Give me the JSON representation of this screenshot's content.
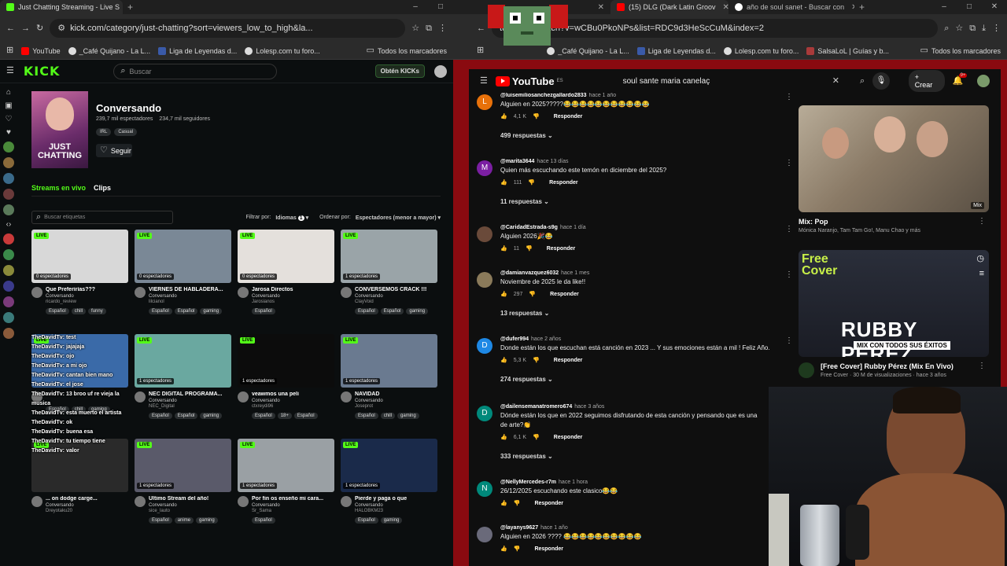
{
  "left_window": {
    "tabs": [
      {
        "label": "Just Chatting Streaming - Live S"
      }
    ],
    "url": "kick.com/category/just-chatting?sort=viewers_low_to_high&la...",
    "bookmarks": [
      "YouTube",
      "_Café Quijano - La L...",
      "Liga de Leyendas d...",
      "Lolesp.com tu foro...",
      "Todos los marcadores"
    ],
    "kick": {
      "logo": "KICK",
      "search_placeholder": "Buscar",
      "cta": "Obtén KICKs",
      "category": {
        "title": "Conversando",
        "viewers": "239,7 mil espectadores",
        "followers": "234,7 mil seguidores",
        "chips": [
          "IRL",
          "Casual"
        ],
        "follow_label": "Seguir",
        "image_text": "JUST CHATTING"
      },
      "tabs": [
        "Streams en vivo",
        "Clips"
      ],
      "tag_search_placeholder": "Buscar etiquetas",
      "filter_label": "Filtrar por:",
      "filter_value": "Idiomas",
      "filter_count": "1",
      "sort_label": "Ordenar por:",
      "sort_value": "Espectadores (menor a mayor)",
      "live_badge": "LIVE",
      "streams": [
        {
          "title": "Que Preferirías???",
          "category": "Conversando",
          "user": "ricardo_review",
          "viewers": "0 espectadores",
          "tags": [
            "Español",
            "chill",
            "funny"
          ],
          "bg": "#d8d8d8"
        },
        {
          "title": "VIERNES DE HABLADERA...",
          "category": "Conversando",
          "user": "lilcianol",
          "viewers": "0 espectadores",
          "tags": [
            "Español",
            "Español",
            "gaming"
          ],
          "bg": "#7a8896"
        },
        {
          "title": "Jarosa Directos",
          "category": "Conversando",
          "user": "Jarosianos",
          "viewers": "0 espectadores",
          "tags": [
            "Español"
          ],
          "bg": "#e4e0dc"
        },
        {
          "title": "CONVERSEMOS CRACK !!!",
          "category": "Conversando",
          "user": "ClayVoid",
          "viewers": "1 espectadores",
          "tags": [
            "Español",
            "Español",
            "gaming"
          ],
          "bg": "#9aa4a8"
        },
        {
          "title": "",
          "category": "",
          "user": "",
          "viewers": "",
          "tags": [
            "Español",
            "chill",
            "gaming"
          ],
          "bg": "#3a6aa8"
        },
        {
          "title": "NEC DIGITAL PROGRAMA...",
          "category": "Conversando",
          "user": "NEC_Digital",
          "viewers": "1 espectadores",
          "tags": [
            "Español",
            "Español",
            "gaming"
          ],
          "bg": "#6aa8a0"
        },
        {
          "title": "veawmos una peli",
          "category": "Conversando",
          "user": "ctxreydi96",
          "viewers": "1 espectadores",
          "tags": [
            "Español",
            "18+",
            "Español"
          ],
          "bg": "#0c0c0c"
        },
        {
          "title": "NAVIDAD",
          "category": "Conversando",
          "user": "Joseprot",
          "viewers": "1 espectadores",
          "tags": [
            "Español",
            "chill",
            "gaming"
          ],
          "bg": "#6a7a90"
        },
        {
          "title": "... on dodge carge...",
          "category": "Conversando",
          "user": "Dreyotaku20",
          "viewers": "",
          "tags": [],
          "bg": "#2a2a2a"
        },
        {
          "title": "Ultimo Stream del año!",
          "category": "Conversando",
          "user": "sice_lauto",
          "viewers": "1 espectadores",
          "tags": [
            "Español",
            "anime",
            "gaming"
          ],
          "bg": "#5a5a6a"
        },
        {
          "title": "Por fin os enseño mi cara...",
          "category": "Conversando",
          "user": "Sr_Sama",
          "viewers": "1 espectadores",
          "tags": [
            "Español"
          ],
          "bg": "#9aa0a4"
        },
        {
          "title": "Pierde y paga o que",
          "category": "Conversando",
          "user": "HALOBKM23",
          "viewers": "1 espectadores",
          "tags": [
            "Español",
            "gaming"
          ],
          "bg": "#1a2a4a"
        }
      ],
      "chat_overlay": [
        "TheDavidTv: test",
        "TheDavidTv: jajajaja",
        "TheDavidTv: ojo",
        "TheDavidTv: a mi ojo",
        "TheDavidTv: cantan bien mano",
        "TheDavidTv: el jose",
        "TheDavidTv: 13 broo uf re vieja la musica",
        "TheDavidTv: esta muerto el artista",
        "TheDavidTv: ok",
        "TheDavidTv: buena esa",
        "TheDavidTv: tu tiempo tiene",
        "TheDavidTv: valor"
      ]
    }
  },
  "right_window": {
    "tabs": [
      {
        "label": "(15) DLG (Dark Latin Groov"
      },
      {
        "label": "año de soul sanet - Buscar con"
      }
    ],
    "url": "tube.com/watch?v=wCBu0PkoNPs&list=RDC9d3HeScCuM&index=2",
    "bookmarks": [
      "_Café Quijano - La L...",
      "Liga de Leyendas d...",
      "Lolesp.com tu foro...",
      "SalsaLoL | Guías y b...",
      "Todos los marcadores"
    ],
    "youtube": {
      "logo": "YouTube",
      "logo_sup": "ES",
      "search_value": "soul sante maria canelaç",
      "create_label": "Crear",
      "notif_count": "9+",
      "reply_label": "Responder",
      "comments": [
        {
          "author": "@luisemiliosanchezgallardo2833",
          "time": "hace 1 año",
          "text": "Alguien en 2025?????😂😂😂😂😂😂😂😂😂😂😂",
          "likes": "4,1 K",
          "replies": "499 respuestas",
          "avatar": "L",
          "color": "#e8710a"
        },
        {
          "author": "@marita3644",
          "time": "hace 13 días",
          "text": "Quien más escuchando este temón en diciembre del 2025?",
          "likes": "111",
          "replies": "11 respuestas",
          "avatar": "M",
          "color": "#7b1fa2"
        },
        {
          "author": "@CaridadEstrada-s9g",
          "time": "hace 1 día",
          "text": "Alguien 2026🎉😂",
          "likes": "11",
          "replies": "",
          "avatar": "",
          "color": "#6a4a3a"
        },
        {
          "author": "@damianvazquez6032",
          "time": "hace 1 mes",
          "text": "Noviembre de 2025 le da like!!",
          "likes": "297",
          "replies": "13 respuestas",
          "avatar": "",
          "color": "#8a7a5a"
        },
        {
          "author": "@dufer994",
          "time": "hace 2 años",
          "text": "Donde están los que escuchan está canción en 2023 ... Y sus emociones están a mil ! Feliz Año.",
          "likes": "5,3 K",
          "replies": "274 respuestas",
          "avatar": "D",
          "color": "#1e88e5"
        },
        {
          "author": "@dailensemanatromero674",
          "time": "hace 3 años",
          "text": "Dónde están los que en 2022 seguimos disfrutando de esta canción y pensando que es una",
          "text2": "de arte?👏",
          "likes": "6,1 K",
          "replies": "333 respuestas",
          "avatar": "D",
          "color": "#00897b"
        },
        {
          "author": "@NellyMercedes-r7m",
          "time": "hace 1 hora",
          "text": "26/12/2025 escuchando este clasico😂😂",
          "likes": "",
          "replies": "",
          "avatar": "N",
          "color": "#00897b"
        },
        {
          "author": "@layanys9627",
          "time": "hace 1 año",
          "text": "Alguien en 2026 ???? 😂😂😂😂😂😂😂😂😂😂",
          "likes": "",
          "replies": "",
          "avatar": "",
          "color": "#6a6a7a"
        }
      ],
      "side_videos": [
        {
          "title": "Mix: Pop",
          "sub": "Mónica Naranjo, Tam Tam Go!, Manu Chao y más",
          "badge": "Mix"
        },
        {
          "title": "[Free Cover] Rubby Pérez (Mix En Vivo)",
          "channel": "Free Cover",
          "sub": "30 M de visualizaciones · hace 3 años",
          "thumb_top": "Free Cover",
          "thumb_name": "RUBBY PÉREZ",
          "thumb_sub": "MIX CON TODOS SUS ÉXITOS"
        }
      ]
    }
  },
  "colors": {
    "kick_green": "#53fc18",
    "yt_red": "#ff0000",
    "bg_dark": "#0f0f0f"
  }
}
